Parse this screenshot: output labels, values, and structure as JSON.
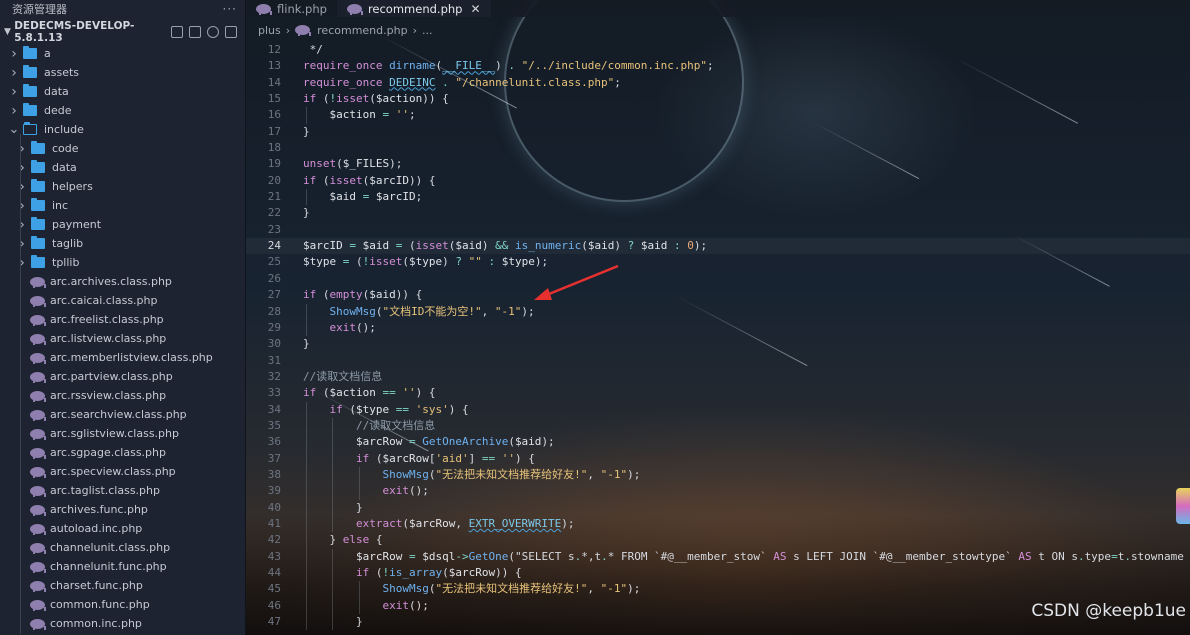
{
  "sidebar": {
    "header_title": "资源管理器",
    "header_menu": "···",
    "root_folder": "DEDECMS-DEVELOP-5.8.1.13",
    "top_folders": [
      "a",
      "assets",
      "data",
      "dede"
    ],
    "open_folder": "include",
    "sub_folders": [
      "code",
      "data",
      "helpers",
      "inc",
      "payment",
      "taglib",
      "tpllib"
    ],
    "files": [
      "arc.archives.class.php",
      "arc.caicai.class.php",
      "arc.freelist.class.php",
      "arc.listview.class.php",
      "arc.memberlistview.class.php",
      "arc.partview.class.php",
      "arc.rssview.class.php",
      "arc.searchview.class.php",
      "arc.sglistview.class.php",
      "arc.sgpage.class.php",
      "arc.specview.class.php",
      "arc.taglist.class.php",
      "archives.func.php",
      "autoload.inc.php",
      "channelunit.class.php",
      "channelunit.func.php",
      "charset.func.php",
      "common.func.php",
      "common.inc.php"
    ]
  },
  "tabs": [
    {
      "label": "flink.php",
      "active": false
    },
    {
      "label": "recommend.php",
      "active": true,
      "close": "✕"
    }
  ],
  "breadcrumb": {
    "folder": "plus",
    "sep": "›",
    "file": "recommend.php",
    "more": "..."
  },
  "current_line": "24",
  "code_lines": [
    {
      "n": "12",
      "t": " */"
    },
    {
      "n": "13",
      "t": "require_once dirname(__FILE__) . \"/../include/common.inc.php\";"
    },
    {
      "n": "14",
      "t": "require_once DEDEINC . \"/channelunit.class.php\";"
    },
    {
      "n": "15",
      "t": "if (!isset($action)) {"
    },
    {
      "n": "16",
      "t": "    $action = '';"
    },
    {
      "n": "17",
      "t": "}"
    },
    {
      "n": "18",
      "t": ""
    },
    {
      "n": "19",
      "t": "unset($_FILES);"
    },
    {
      "n": "20",
      "t": "if (isset($arcID)) {"
    },
    {
      "n": "21",
      "t": "    $aid = $arcID;"
    },
    {
      "n": "22",
      "t": "}"
    },
    {
      "n": "23",
      "t": ""
    },
    {
      "n": "24",
      "t": "$arcID = $aid = (isset($aid) && is_numeric($aid) ? $aid : 0);"
    },
    {
      "n": "25",
      "t": "$type = (!isset($type) ? \"\" : $type);"
    },
    {
      "n": "26",
      "t": ""
    },
    {
      "n": "27",
      "t": "if (empty($aid)) {"
    },
    {
      "n": "28",
      "t": "    ShowMsg(\"文档ID不能为空!\", \"-1\");"
    },
    {
      "n": "29",
      "t": "    exit();"
    },
    {
      "n": "30",
      "t": "}"
    },
    {
      "n": "31",
      "t": ""
    },
    {
      "n": "32",
      "t": "//读取文档信息"
    },
    {
      "n": "33",
      "t": "if ($action == '') {"
    },
    {
      "n": "34",
      "t": "    if ($type == 'sys') {"
    },
    {
      "n": "35",
      "t": "        //读取文档信息"
    },
    {
      "n": "36",
      "t": "        $arcRow = GetOneArchive($aid);"
    },
    {
      "n": "37",
      "t": "        if ($arcRow['aid'] == '') {"
    },
    {
      "n": "38",
      "t": "            ShowMsg(\"无法把未知文档推荐给好友!\", \"-1\");"
    },
    {
      "n": "39",
      "t": "            exit();"
    },
    {
      "n": "40",
      "t": "        }"
    },
    {
      "n": "41",
      "t": "        extract($arcRow, EXTR_OVERWRITE);"
    },
    {
      "n": "42",
      "t": "    } else {"
    },
    {
      "n": "43",
      "t": "        $arcRow = $dsql->GetOne(\"SELECT s.*,t.* FROM `#@__member_stow` AS s LEFT JOIN `#@__member_stowtype` AS t ON s.type=t.stowname"
    },
    {
      "n": "44",
      "t": "        if (!is_array($arcRow)) {"
    },
    {
      "n": "45",
      "t": "            ShowMsg(\"无法把未知文档推荐给好友!\", \"-1\");"
    },
    {
      "n": "46",
      "t": "            exit();"
    },
    {
      "n": "47",
      "t": "        }"
    }
  ],
  "watermark": "CSDN @keepb1ue",
  "colors": {
    "arrow": "#e8312f",
    "folder": "#3ea1e6",
    "php_icon": "#8f7fae"
  }
}
